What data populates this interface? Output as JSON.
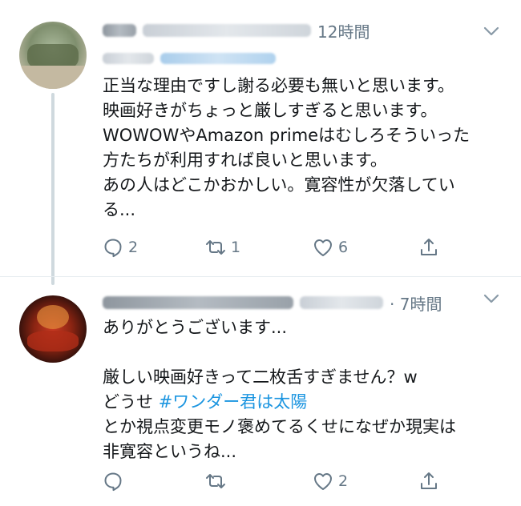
{
  "tweets": [
    {
      "time": "12時間",
      "text": "正当な理由ですし謝る必要も無いと思います。\n映画好きがちょっと厳しすぎると思います。\nWOWOWやAmazon primeはむしろそういった\n方たちが利用すれば良いと思います。\nあの人はどこかおかしい。寛容性が欠落してい\nる...",
      "reply_count": "2",
      "retweet_count": "1",
      "like_count": "6"
    },
    {
      "time": "· 7時間",
      "text_before": "ありがとうございます...\n\n厳しい映画好きって二枚舌すぎません？w\nどうせ ",
      "hashtag": "#ワンダー君は太陽",
      "text_after": "\nとか視点変更モノ褒めてるくせになぜか現実は\n非寛容というね...",
      "reply_count": "",
      "retweet_count": "",
      "like_count": "2"
    }
  ],
  "icons": [
    "reply-icon",
    "retweet-icon",
    "like-icon",
    "share-icon",
    "chevron-down-icon"
  ],
  "colors": {
    "accent": "#1b95e0",
    "secondary_text": "#657786",
    "thread_line": "#cfd9de"
  }
}
